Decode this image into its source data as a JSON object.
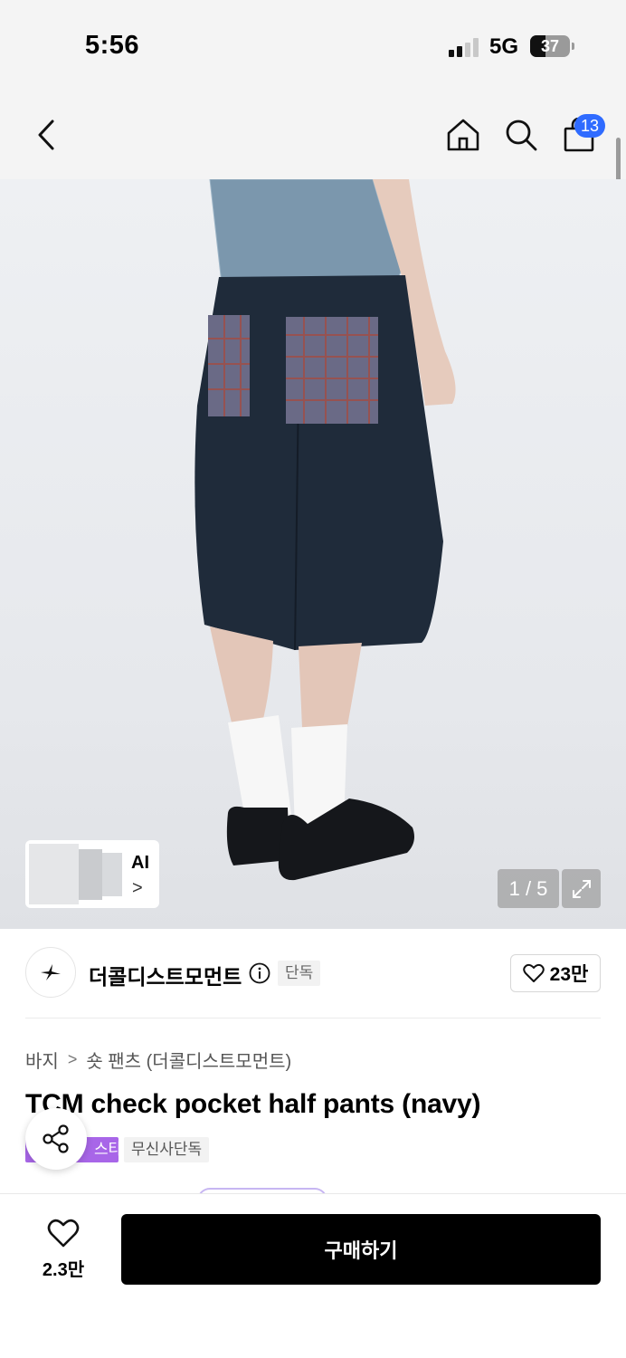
{
  "status_bar": {
    "time": "5:56",
    "network": "5G",
    "battery": "37"
  },
  "nav": {
    "back_icon": "chevron-left-icon",
    "home_icon": "home-icon",
    "search_icon": "search-icon",
    "cart_icon": "bag-icon",
    "cart_count": "13"
  },
  "gallery": {
    "ai_label": "AI",
    "ai_chevron": ">",
    "counter": "1 / 5"
  },
  "brand": {
    "name": "더콜디스트모먼트",
    "exclusive_tag": "단독",
    "like_count": "23만"
  },
  "product": {
    "breadcrumb": [
      "바지",
      "숏 팬츠 (더콜디스트모먼트)"
    ],
    "breadcrumb_sep": ">",
    "title": "TCM check pocket half pants (navy)",
    "badges": [
      "스타",
      "무신사단독"
    ]
  },
  "bottom_bar": {
    "wish_count": "2.3만",
    "buy_label": "구매하기"
  },
  "colors": {
    "accent_blue": "#2f6bff",
    "badge_purple": "#a866e8",
    "buy_button": "#000000"
  }
}
